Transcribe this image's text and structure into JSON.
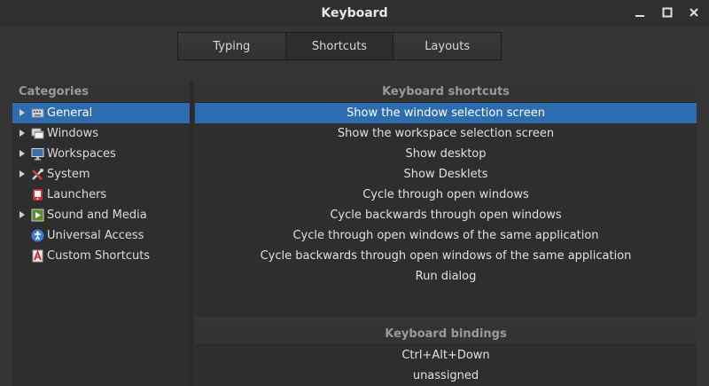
{
  "window": {
    "title": "Keyboard"
  },
  "tabs": [
    {
      "label": "Typing"
    },
    {
      "label": "Shortcuts"
    },
    {
      "label": "Layouts"
    }
  ],
  "categories": {
    "header": "Categories",
    "items": [
      {
        "label": "General",
        "icon": "keyboard-icon",
        "expandable": true,
        "selected": true
      },
      {
        "label": "Windows",
        "icon": "windows-icon",
        "expandable": true
      },
      {
        "label": "Workspaces",
        "icon": "monitor-icon",
        "expandable": true
      },
      {
        "label": "System",
        "icon": "tools-icon",
        "expandable": true
      },
      {
        "label": "Launchers",
        "icon": "launchers-icon",
        "expandable": false
      },
      {
        "label": "Sound and Media",
        "icon": "media-icon",
        "expandable": true
      },
      {
        "label": "Universal Access",
        "icon": "accessibility-icon",
        "expandable": false
      },
      {
        "label": "Custom Shortcuts",
        "icon": "custom-icon",
        "expandable": false
      }
    ]
  },
  "shortcuts": {
    "header": "Keyboard shortcuts",
    "items": [
      "Show the window selection screen",
      "Show the workspace selection screen",
      "Show desktop",
      "Show Desklets",
      "Cycle through open windows",
      "Cycle backwards through open windows",
      "Cycle through open windows of the same application",
      "Cycle backwards through open windows of the same application",
      "Run dialog"
    ],
    "selected_index": 0
  },
  "bindings": {
    "header": "Keyboard bindings",
    "items": [
      "Ctrl+Alt+Down",
      "unassigned"
    ]
  },
  "colors": {
    "selection": "#2e6cb0",
    "background": "#353535",
    "pane": "#2e2e2e"
  }
}
